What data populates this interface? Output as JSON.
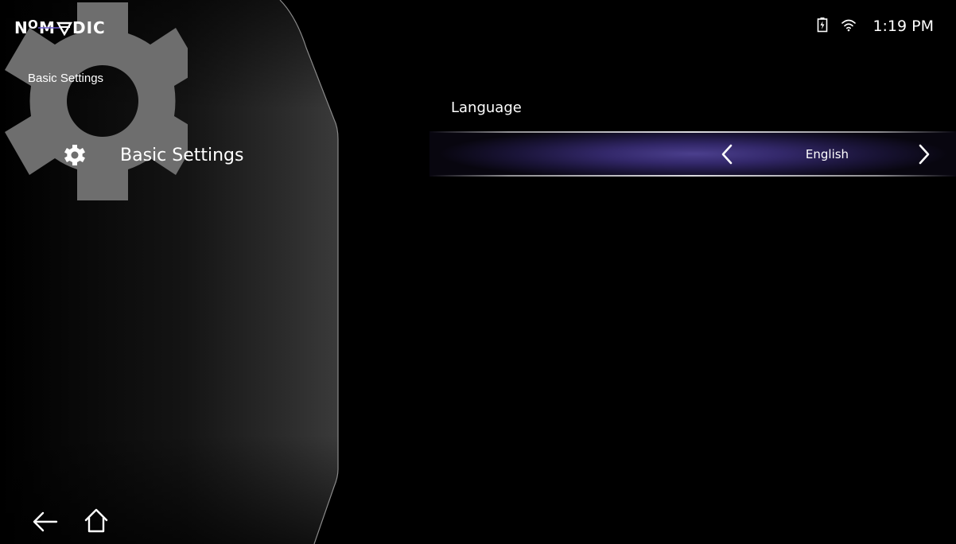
{
  "app": {
    "brand": "NOMADIC"
  },
  "status": {
    "time": "1:19 PM",
    "icons": [
      "battery-charging-icon",
      "wifi-icon"
    ]
  },
  "sidebar": {
    "breadcrumb": "Basic Settings",
    "items": [
      {
        "label": "Basic Settings",
        "icon": "gear-icon",
        "selected": true
      }
    ],
    "background_icon": "gear-icon"
  },
  "nav": {
    "back_icon": "back-arrow-icon",
    "home_icon": "home-icon"
  },
  "settings": {
    "language": {
      "label": "Language",
      "value": "English",
      "prev_icon": "chevron-left-icon",
      "next_icon": "chevron-right-icon"
    }
  },
  "colors": {
    "background": "#000000",
    "selection_accent": "#4b3f8d",
    "panel_gear": "#6e6e6e",
    "text": "#ffffff"
  }
}
